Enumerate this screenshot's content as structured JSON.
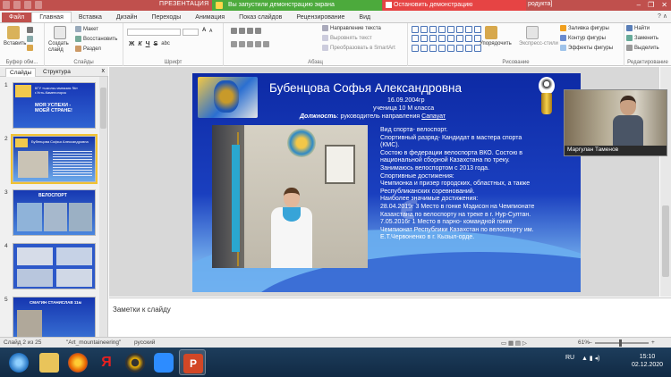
{
  "titlebar": {
    "app_title": "ПРЕЗЕНТАЦИЯ",
    "share_text": "Вы запустили демонстрацию экрана",
    "stop_text": "Остановить демонстрацию",
    "rest_text": "родукта]",
    "win_minimize": "–",
    "win_restore": "❐",
    "win_close": "✕"
  },
  "ribbon_tabs": [
    "Файл",
    "Главная",
    "Вставка",
    "Дизайн",
    "Переходы",
    "Анимация",
    "Показ слайдов",
    "Рецензирование",
    "Вид"
  ],
  "ribbon": {
    "paste": "Вставить",
    "new_slide": "Создать\nслайд",
    "layout": "Макет",
    "reset": "Восстановить",
    "section": "Раздел",
    "clipboard_label": "Буфер обм...",
    "slides_label": "Слайды",
    "font_label": "Шрифт",
    "paragraph_label": "Абзац",
    "text_direction": "Направление текста",
    "align_text": "Выровнять текст",
    "smartart": "Преобразовать в SmartArt",
    "arrange": "Упорядочить",
    "quick_styles": "Экспресс-стили",
    "shape_fill": "Заливка фигуры",
    "shape_outline": "Контур фигуры",
    "shape_effects": "Эффекты фигуры",
    "drawing_label": "Рисование",
    "find": "Найти",
    "replace": "Заменить",
    "select": "Выделить",
    "editing_label": "Редактирование",
    "bold": "Ж",
    "italic": "К",
    "underline": "Ч",
    "strike": "S",
    "shadow": "abc",
    "font_size_up": "A",
    "font_size_down": "A"
  },
  "left_panel": {
    "tab_slides": "Слайды",
    "tab_outline": "Структура",
    "close": "x",
    "slide_numbers": [
      "1",
      "2",
      "3",
      "4",
      "5"
    ],
    "thumb_texts": [
      "КГУ «школа-гимназия №»\nг.Усть-Каменогорск",
      "Бубенцова Софья Александровна",
      "ВЕЛОСПОРТ",
      "",
      "СМАГИН СТАНИСЛАВ 11м"
    ],
    "thumb1_big": "МОЯ УСПЕХИ -\nМОЕЙ СТРАНЕ!"
  },
  "slide": {
    "name": "Бубенцова Софья Александровна",
    "dob": "16.09.2004гр",
    "class": "ученица 10 М класса",
    "position_label": "Должность",
    "position_text": ": руководитель направления",
    "position_link": "Сапауат",
    "body_lines": [
      "Вид спорта- велоспорт.",
      "Спортивный разряд- Кандидат в мастера спорта",
      "(КМС).",
      "Состою в федерации велоспорта ВКО. Состою в",
      "национальной  сборной Казахстана по треку.",
      "Занимаюсь велоспортом с 2013 года.",
      "Спортивные достижения:",
      "Чемпионка и призер городских, областных, а также",
      "Республиканских соревнований.",
      "Наиболее значимые достижения:",
      "28.04.2019г   3 Место в гонке Мэдисон на Чемпионате",
      "Казахстана по велоспорту на треке в г. Нур-Султан.",
      "7.05.2016г    1 Место в парно- командной гонке",
      "Чемпионат Республики Казахстан по велоспорту им.",
      "Е.Т.Червоненко в г. Кызыл-орде."
    ]
  },
  "video": {
    "participant": "Маргулан Таменов"
  },
  "notes": {
    "placeholder": "Заметки к слайду"
  },
  "status": {
    "slide_info": "Слайд 2 из 25",
    "theme": "\"Art_mountaineering\"",
    "language": "русский",
    "zoom": "61%",
    "zoom_minus": "–",
    "zoom_plus": "+"
  },
  "taskbar": {
    "lang": "RU",
    "time": "15:10",
    "date": "02.12.2020"
  },
  "colors": {
    "title_red": "#c0504d",
    "share_green": "#4caa3c",
    "stop_red": "#e64444",
    "slide_blue": "#1a3fbf"
  }
}
